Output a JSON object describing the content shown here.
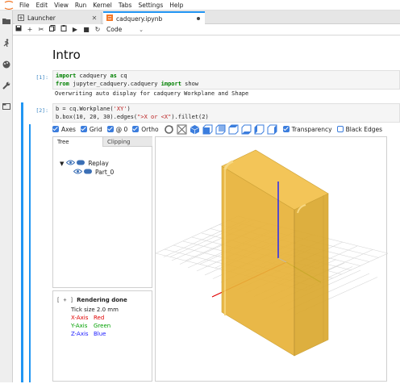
{
  "menu": [
    "File",
    "Edit",
    "View",
    "Run",
    "Kernel",
    "Tabs",
    "Settings",
    "Help"
  ],
  "tabs": [
    {
      "label": "Launcher",
      "active": false
    },
    {
      "label": "cadquery.ipynb",
      "active": true
    }
  ],
  "toolbar": {
    "cell_type": "Code"
  },
  "notebook": {
    "heading": "Intro",
    "cell1": {
      "prompt": "[1]:",
      "line1": {
        "k1": "import",
        "t1": " cadquery ",
        "k2": "as",
        "t2": " cq"
      },
      "line2": {
        "k1": "from",
        "t1": " jupyter_cadquery.cadquery ",
        "k2": "import",
        "t2": " show"
      },
      "output": "Overwriting auto display for cadquery Workplane and Shape"
    },
    "cell2": {
      "prompt": "[2]:",
      "line1": {
        "a": "b = cq.Workplane(",
        "s": "'XY'",
        "b": ")"
      },
      "line2": {
        "a": "b.box(10, 20, 30).edges(",
        "s": "\">X or <X\"",
        "b": ").fillet(2)"
      }
    }
  },
  "viewer": {
    "checkboxes": [
      {
        "label": "Axes",
        "checked": true
      },
      {
        "label": "Grid",
        "checked": true
      },
      {
        "label": "@ 0",
        "checked": true
      },
      {
        "label": "Ortho",
        "checked": true
      }
    ],
    "transparency": {
      "label": "Transparency",
      "checked": true
    },
    "black_edges": {
      "label": "Black Edges",
      "checked": false
    },
    "tabs": {
      "tree": "Tree",
      "clipping": "Clipping"
    },
    "tree": {
      "root": "Replay",
      "child": "Part_0"
    },
    "info": {
      "bracket": "[ + ]",
      "title": "Rendering done",
      "tick": "Tick size 2.0 mm",
      "x_axis": "X-Axis",
      "x_color": "Red",
      "y_axis": "Y-Axis",
      "y_color": "Green",
      "z_axis": "Z-Axis",
      "z_color": "Blue"
    }
  },
  "colors": {
    "accent": "#2196f3",
    "part": "#e8b339",
    "x": "#e00000",
    "y": "#00a000",
    "z": "#1a1aff"
  }
}
